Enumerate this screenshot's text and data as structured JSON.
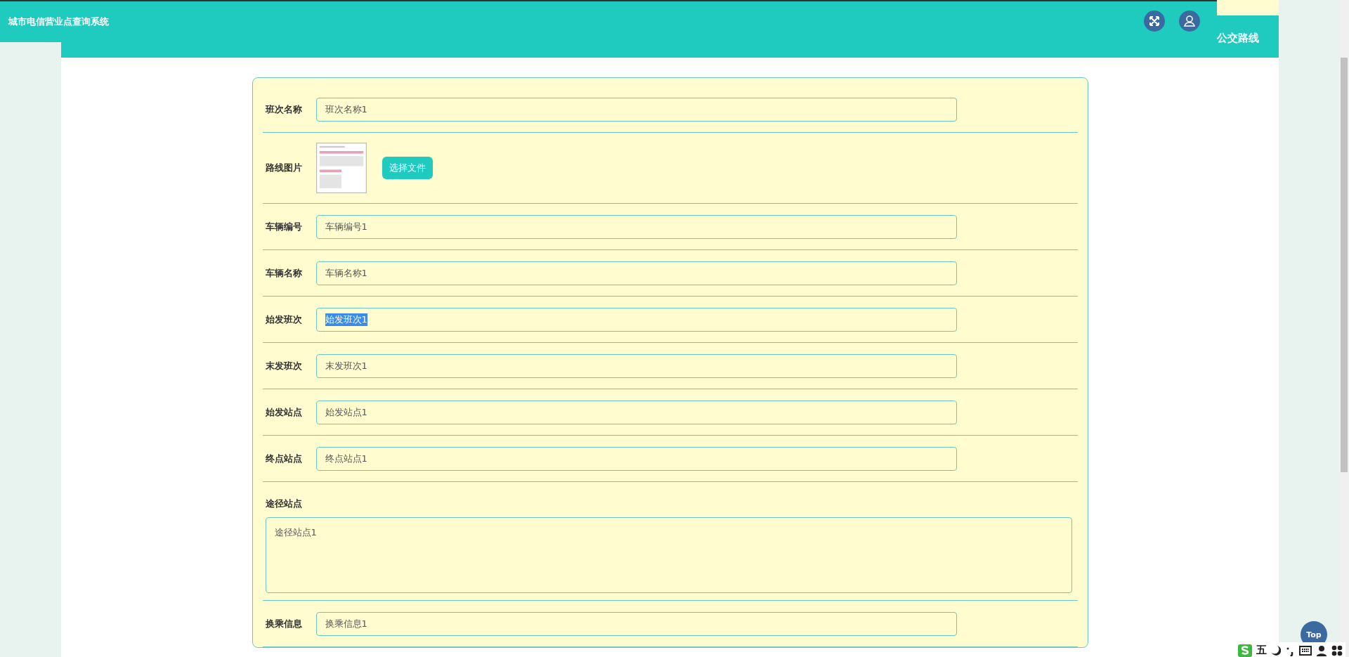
{
  "app": {
    "title": "城市电信营业点查询系统"
  },
  "header": {
    "breadcrumb_tail": "公交路线"
  },
  "form": {
    "fields": [
      {
        "kind": "input",
        "label": "班次名称",
        "value": "班次名称1",
        "text_selected": false
      },
      {
        "label": "路线图片",
        "button": "选择文件"
      },
      {
        "kind": "input",
        "label": "车辆编号",
        "value": "车辆编号1",
        "text_selected": false
      },
      {
        "kind": "input",
        "label": "车辆名称",
        "value": "车辆名称1",
        "text_selected": false
      },
      {
        "kind": "input",
        "label": "始发班次",
        "value": "始发班次1",
        "text_selected": true
      },
      {
        "kind": "input",
        "label": "末发班次",
        "value": "末发班次1",
        "text_selected": false
      },
      {
        "kind": "input",
        "label": "始发站点",
        "value": "始发站点1",
        "text_selected": false
      },
      {
        "kind": "input",
        "label": "终点站点",
        "value": "终点站点1",
        "text_selected": false
      },
      {
        "kind": "textarea",
        "label": "途径站点",
        "value": "途径站点1",
        "text_selected": false
      },
      {
        "kind": "input",
        "label": "换乘信息",
        "value": "换乘信息1",
        "text_selected": false
      }
    ]
  },
  "back_to_top": "Top",
  "ime": {
    "mode": "五"
  }
}
